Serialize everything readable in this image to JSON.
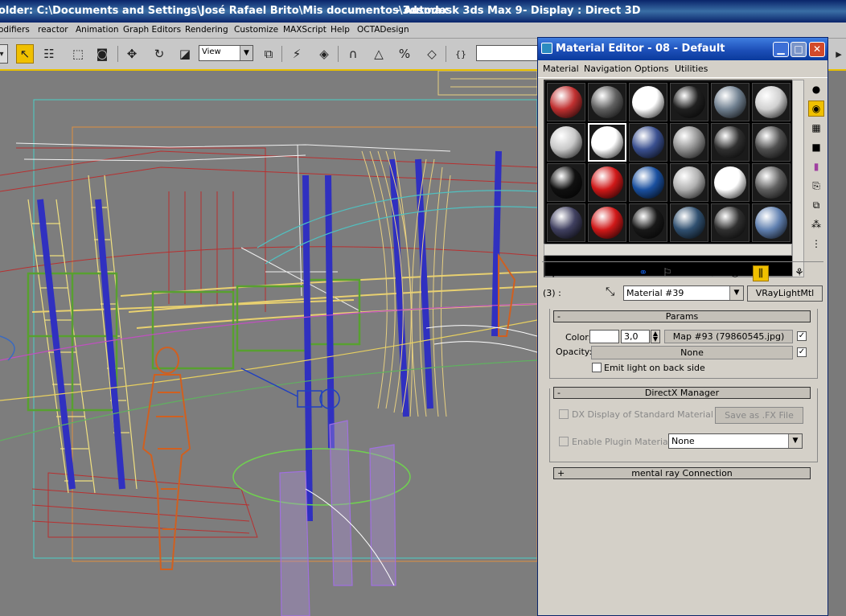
{
  "window": {
    "title_path": "older: C:\\Documents and Settings\\José Rafael Brito\\Mis documentos\\3dsmax",
    "title_app": "- Autodesk 3ds Max 9",
    "title_display": "- Display : Direct 3D"
  },
  "menu": [
    "odifiers",
    "reactor",
    "Animation",
    "Graph Editors",
    "Rendering",
    "Customize",
    "MAXScript",
    "Help",
    "OCTADesign"
  ],
  "toolbar": {
    "view_dropdown": "View"
  },
  "material_editor": {
    "title": "Material Editor - 08 - Default",
    "menu": [
      "Material",
      "Navigation",
      "Options",
      "Utilities"
    ],
    "slot_colors": [
      [
        "#c03030",
        "#606060",
        "#ffffff",
        "#202020",
        "#708090",
        "#d0d0d0"
      ],
      [
        "#c8c8c8",
        "#ffffff",
        "#3a5090",
        "#909090",
        "#303030",
        "#505050"
      ],
      [
        "#101010",
        "#d01818",
        "#1a50a0",
        "#b0b0b0",
        "#ffffff",
        "#606060"
      ],
      [
        "#404060",
        "#d01818",
        "#181818",
        "#305070",
        "#303030",
        "#6080b0"
      ]
    ],
    "level_label": "(3) :",
    "material_name": "Material #39",
    "material_type": "VRayLightMtl",
    "params": {
      "header": "Params",
      "color_label": "Color:",
      "color_value": "#ffffff",
      "multiplier": "3,0",
      "map_button": "Map #93 (79860545.jpg)",
      "opacity_label": "Opacity:",
      "opacity_button": "None",
      "emit_back_label": "Emit light on back side"
    },
    "directx": {
      "header": "DirectX Manager",
      "dx_display_label": "DX Display of Standard Material",
      "save_fx_label": "Save as .FX File",
      "enable_plugin_label": "Enable Plugin Material",
      "plugin_value": "None"
    },
    "mental_ray": {
      "header": "mental ray Connection"
    }
  }
}
